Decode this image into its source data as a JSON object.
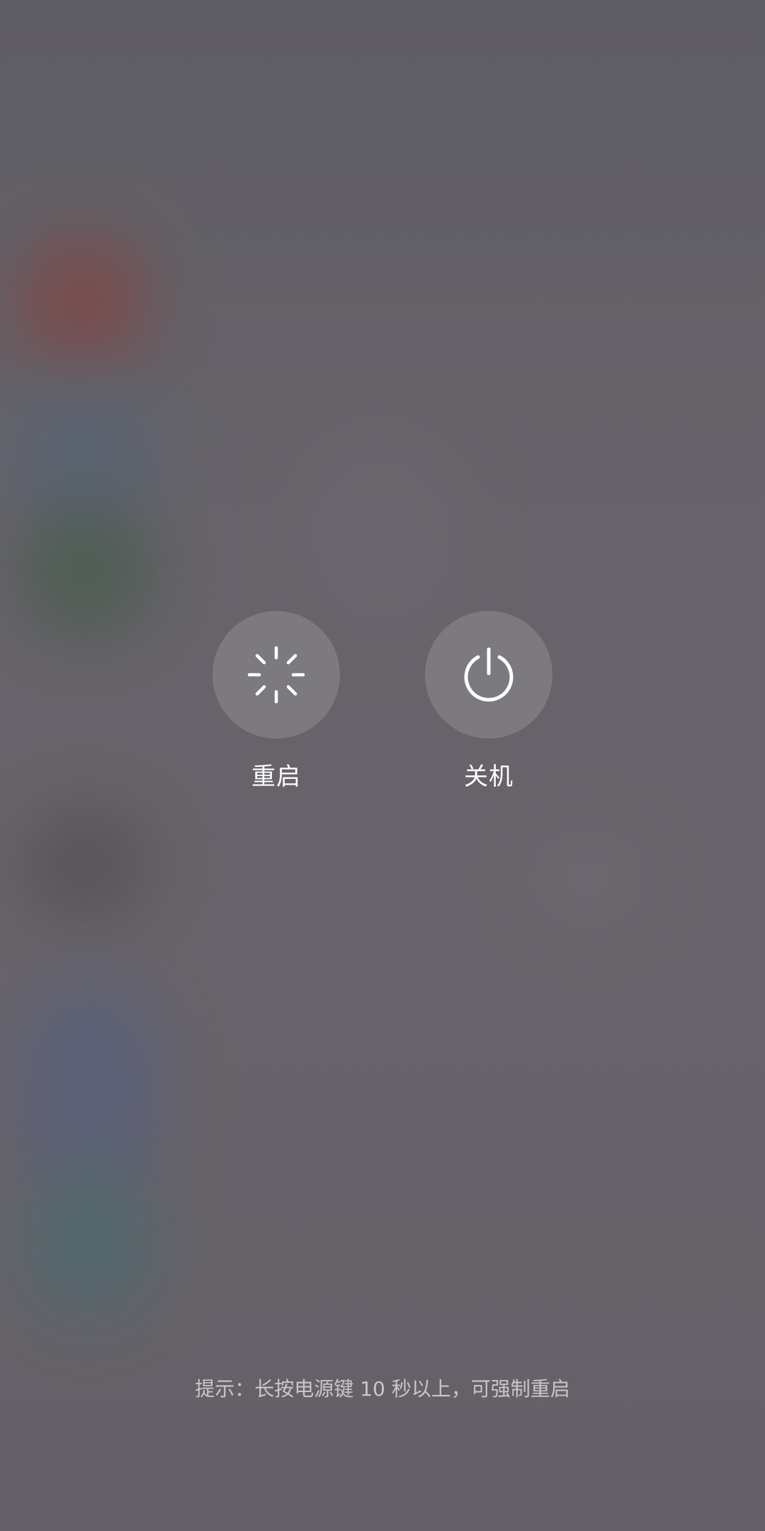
{
  "power_menu": {
    "restart": {
      "label": "重启",
      "icon": "restart-spinner-icon"
    },
    "power_off": {
      "label": "关机",
      "icon": "power-icon"
    }
  },
  "hint": "提示：长按电源键 10 秒以上，可强制重启",
  "colors": {
    "backdrop": "#666267",
    "text": "#ffffff",
    "hint_text": "#c9c6cb"
  }
}
